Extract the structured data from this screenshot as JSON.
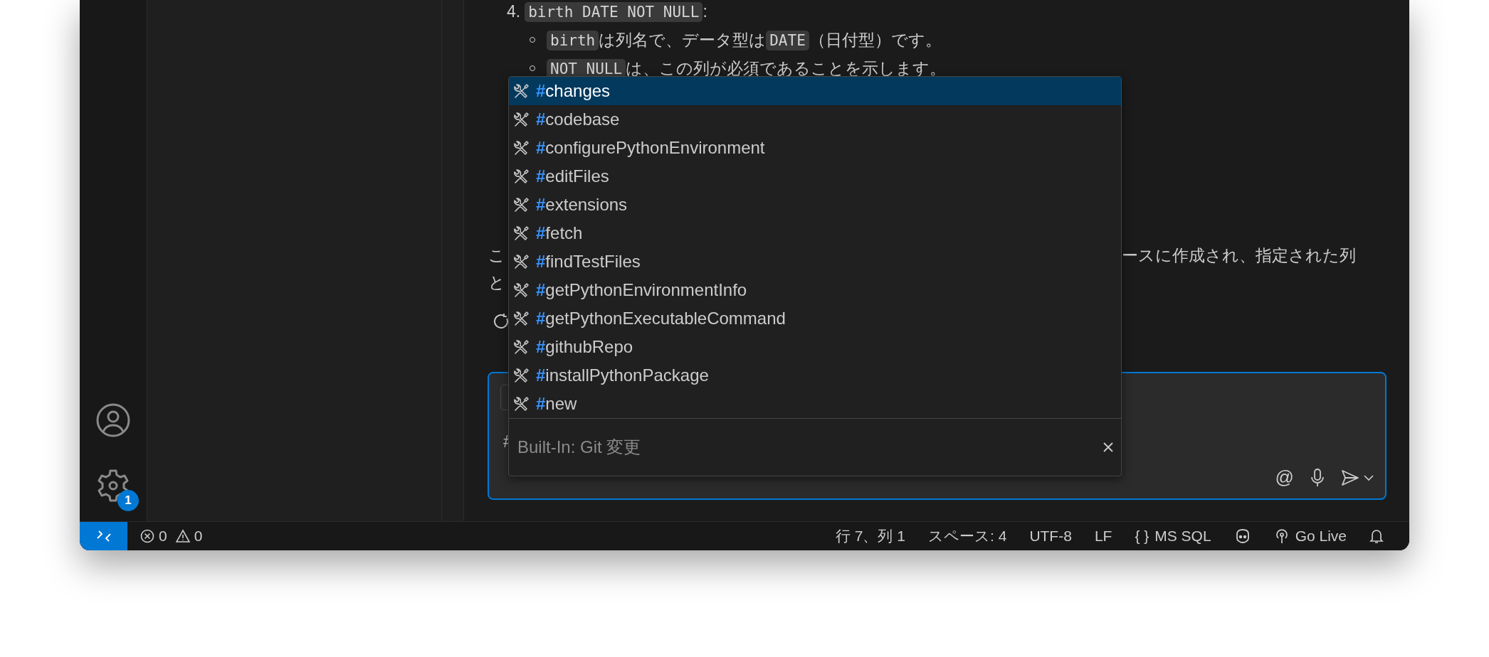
{
  "chat": {
    "list_item": {
      "number": "4.",
      "code": "birth DATE NOT NULL",
      "suffix": ":"
    },
    "sub_items": [
      {
        "segments": [
          {
            "kind": "code",
            "text": "birth"
          },
          {
            "kind": "text",
            "text": "は列名で、データ型は"
          },
          {
            "kind": "code",
            "text": "DATE"
          },
          {
            "kind": "text",
            "text": "（日付型）です。"
          }
        ]
      },
      {
        "segments": [
          {
            "kind": "code",
            "text": "NOT NULL"
          },
          {
            "kind": "text",
            "text": "は、この列が必須であることを示します。"
          }
        ]
      }
    ],
    "paragraph_lines": [
      {
        "left": "こ",
        "right": "ースに作成され、指定された列"
      },
      {
        "left": "と"
      }
    ]
  },
  "tool_picker": {
    "items": [
      {
        "prefix": "#",
        "name": "changes",
        "selected": true
      },
      {
        "prefix": "#",
        "name": "codebase",
        "selected": false
      },
      {
        "prefix": "#",
        "name": "configurePythonEnvironment",
        "selected": false
      },
      {
        "prefix": "#",
        "name": "editFiles",
        "selected": false
      },
      {
        "prefix": "#",
        "name": "extensions",
        "selected": false
      },
      {
        "prefix": "#",
        "name": "fetch",
        "selected": false
      },
      {
        "prefix": "#",
        "name": "findTestFiles",
        "selected": false
      },
      {
        "prefix": "#",
        "name": "getPythonEnvironmentInfo",
        "selected": false
      },
      {
        "prefix": "#",
        "name": "getPythonExecutableCommand",
        "selected": false
      },
      {
        "prefix": "#",
        "name": "githubRepo",
        "selected": false
      },
      {
        "prefix": "#",
        "name": "installPythonPackage",
        "selected": false
      },
      {
        "prefix": "#",
        "name": "new",
        "selected": false
      }
    ],
    "placeholder": "Built-In: Git 変更"
  },
  "chat_input": {
    "value": "#",
    "mention_icon": "@"
  },
  "activity_bar": {
    "settings_badge": "1"
  },
  "status_bar": {
    "problems": {
      "errors": "0",
      "warnings": "0"
    },
    "items": [
      {
        "kind": "text",
        "text": "行 7、列 1"
      },
      {
        "kind": "text",
        "text": "スペース: 4"
      },
      {
        "kind": "text",
        "text": "UTF-8"
      },
      {
        "kind": "text",
        "text": "LF"
      },
      {
        "kind": "language",
        "icon_text": "{ }",
        "text": "MS SQL"
      },
      {
        "kind": "copilot"
      },
      {
        "kind": "live",
        "text": "Go Live"
      },
      {
        "kind": "bell"
      }
    ]
  }
}
